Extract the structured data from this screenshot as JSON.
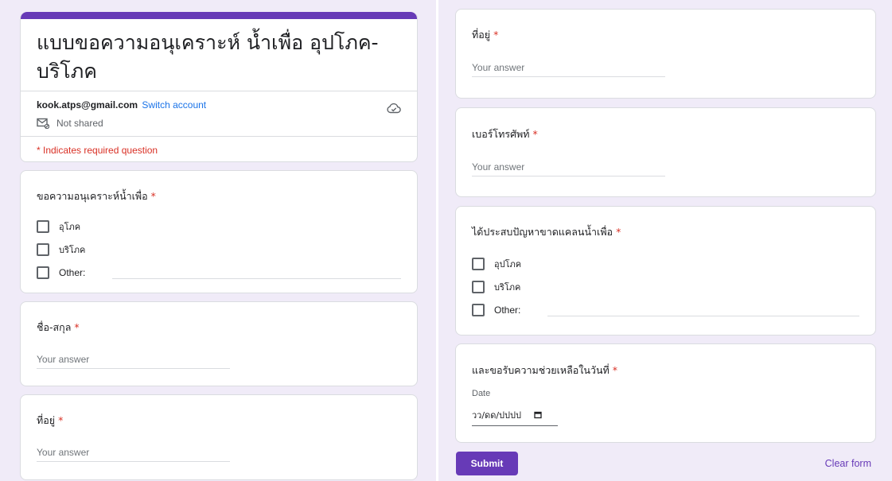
{
  "form": {
    "title": "แบบขอความอนุเคราะห์ น้ำเพื่อ อุปโภค-บริโภค",
    "account_email": "kook.atps@gmail.com",
    "switch_account": "Switch account",
    "not_shared": "Not shared",
    "required_note": "* Indicates required question"
  },
  "questions": {
    "purpose": {
      "label": "ขอความอนุเคราะห์น้ำเพื่อ",
      "required_mark": "*",
      "options": [
        "อุโภค",
        "บริโภค",
        "Other:"
      ]
    },
    "name": {
      "label": "ชื่อ-สกุล",
      "required_mark": "*",
      "placeholder": "Your answer"
    },
    "address_left": {
      "label": "ที่อยู่",
      "required_mark": "*",
      "placeholder": "Your answer"
    },
    "address_right": {
      "label": "ที่อยู่",
      "required_mark": "*",
      "placeholder": "Your answer"
    },
    "phone": {
      "label": "เบอร์โทรศัพท์",
      "required_mark": "*",
      "placeholder": "Your answer"
    },
    "shortage": {
      "label": "ได้ประสบปัญหาขาดแคลนน้ำเพื่อ",
      "required_mark": "*",
      "options": [
        "อุปโภค",
        "บริโภค",
        "Other:"
      ]
    },
    "date": {
      "label": "และขอรับความช่วยเหลือในวันที่",
      "required_mark": "*",
      "sublabel": "Date",
      "placeholder": "วว/ดด/ปปปป"
    }
  },
  "actions": {
    "submit": "Submit",
    "clear": "Clear form"
  },
  "colors": {
    "accent": "#673ab7",
    "background": "#f0ebf8",
    "required": "#d93025",
    "link": "#1a73e8"
  }
}
